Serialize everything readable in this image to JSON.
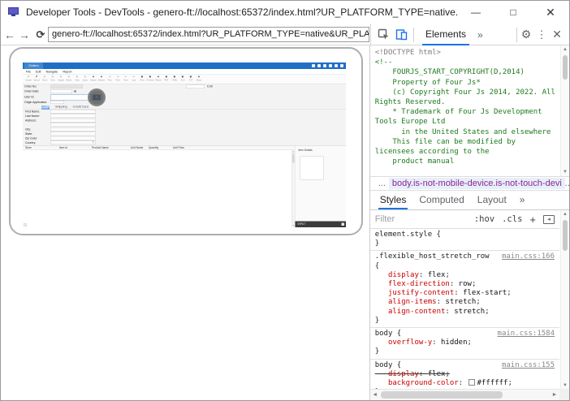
{
  "window": {
    "title": "Developer Tools - DevTools - genero-ft://localhost:65372/index.html?UR_PLATFORM_TYPE=native...",
    "minimize": "—",
    "maximize": "□",
    "close": "✕"
  },
  "navbar": {
    "back": "←",
    "forward": "→",
    "reload": "⟳",
    "url": "genero-ft://localhost:65372/index.html?UR_PLATFORM_TYPE=native&UR_PLATFORM_NAME"
  },
  "devtools": {
    "toolbar": {
      "elements_tab": "Elements",
      "more_tabs": "»",
      "menu_dots": "⋮",
      "close": "✕",
      "gear": "⚙"
    },
    "elements_code": [
      {
        "t": "<!DOCTYPE html>",
        "c": "doctype"
      },
      {
        "t": "<!--",
        "c": "comment"
      },
      {
        "t": "    FOURJS_START_COPYRIGHT(D,2014)",
        "c": "comment"
      },
      {
        "t": "    Property of Four Js*",
        "c": "comment"
      },
      {
        "t": "    (c) Copyright Four Js 2014, 2022. All",
        "c": "comment"
      },
      {
        "t": "Rights Reserved.",
        "c": "comment"
      },
      {
        "t": "    * Trademark of Four Js Development",
        "c": "comment"
      },
      {
        "t": "Tools Europe Ltd",
        "c": "comment"
      },
      {
        "t": "      in the United States and elsewhere",
        "c": "comment"
      },
      {
        "t": "",
        "c": "comment"
      },
      {
        "t": "    This file can be modified by",
        "c": "comment"
      },
      {
        "t": "licensees according to the",
        "c": "comment"
      },
      {
        "t": "    product manual",
        "c": "comment"
      }
    ],
    "crumbs": {
      "collapsed": "...",
      "selected": "body.is-not-mobile-device.is-not-touch-devi",
      "overflow": "..."
    },
    "styles_tabs": [
      "Styles",
      "Computed",
      "Layout",
      "»"
    ],
    "filter": {
      "placeholder": "Filter",
      "hov": ":hov",
      "cls": ".cls",
      "plus": "+"
    },
    "style_rules": [
      {
        "selector": "element.style",
        "link": "",
        "brace": "inline",
        "props": [],
        "close": true
      },
      {
        "selector": ".flexible_host_stretch_row",
        "link": "main.css:166",
        "brace": "ownline",
        "props": [
          {
            "name": "display",
            "value": "flex"
          },
          {
            "name": "flex-direction",
            "value": "row"
          },
          {
            "name": "justify-content",
            "value": "flex-start"
          },
          {
            "name": "align-items",
            "value": "stretch"
          },
          {
            "name": "align-content",
            "value": "stretch"
          }
        ],
        "close": true
      },
      {
        "selector": "body",
        "link": "main.css:1584",
        "brace": "inline",
        "props": [
          {
            "name": "overflow-y",
            "value": "hidden"
          }
        ],
        "close": true
      },
      {
        "selector": "body",
        "link": "main.css:155",
        "brace": "inline",
        "props": [
          {
            "name": "display",
            "value": "flex",
            "struck": true
          },
          {
            "name": "background-color",
            "value": "#ffffff",
            "swatch": "#ffffff"
          }
        ],
        "close": true
      }
    ]
  },
  "app": {
    "title_tab": "Orders",
    "menus": [
      "File",
      "Edit",
      "Navigate",
      "Report"
    ],
    "toolbar": [
      {
        "label": "Accept",
        "glyph": "✓",
        "on": true,
        "color": "#2e7d32"
      },
      {
        "label": "Cancel",
        "glyph": "✗",
        "on": true,
        "color": "#99392e"
      },
      {
        "label": "Close",
        "glyph": "■",
        "on": false
      },
      {
        "label": "New",
        "glyph": "■",
        "on": false
      },
      {
        "label": "Update",
        "glyph": "■",
        "on": false
      },
      {
        "label": "Delete",
        "glyph": "■",
        "on": false
      },
      {
        "label": "Clear",
        "glyph": "■",
        "on": false
      },
      {
        "label": "Query",
        "glyph": "■",
        "on": false
      },
      {
        "label": "Search",
        "glyph": "●",
        "on": true,
        "color": "#44566b"
      },
      {
        "label": "Browse",
        "glyph": "●",
        "on": true,
        "color": "#44566b"
      },
      {
        "label": "First",
        "glyph": "◄",
        "on": false
      },
      {
        "label": "Prev",
        "glyph": "◄",
        "on": false
      },
      {
        "label": "Next",
        "glyph": "►",
        "on": false
      },
      {
        "label": "Last",
        "glyph": "►",
        "on": false
      },
      {
        "label": "Print",
        "glyph": "■",
        "on": true,
        "color": "#4a5560"
      },
      {
        "label": "Preview",
        "glyph": "■",
        "on": true,
        "color": "#4a5560"
      },
      {
        "label": "Report",
        "glyph": "●",
        "on": true,
        "color": "#44566b"
      },
      {
        "label": "PDF",
        "glyph": "■",
        "on": true,
        "color": "#4a5560"
      },
      {
        "label": "HTML",
        "glyph": "■",
        "on": true,
        "color": "#4a5560"
      },
      {
        "label": "XLS",
        "glyph": "■",
        "on": true,
        "color": "#4a5560"
      },
      {
        "label": "TXT",
        "glyph": "■",
        "on": true,
        "color": "#4a5560"
      },
      {
        "label": "About",
        "glyph": "●",
        "on": true,
        "color": "#4a5560"
      }
    ],
    "order_fields": {
      "order_no": "Order No:",
      "order_date": "Order Date:",
      "user_id": "User Id:",
      "origin_app": "Origin Application:",
      "total": "0.00"
    },
    "tabs": [
      {
        "label": "Billing",
        "active": true
      },
      {
        "label": "Shipping",
        "active": false
      },
      {
        "label": "Credit Card",
        "active": false
      }
    ],
    "billing_labels": [
      "First Name:",
      "Last Name:",
      "Address:",
      "",
      "City:",
      "State:",
      "Zip Code:",
      "Country:"
    ],
    "table_headers": [
      "Store",
      "Item Id",
      "Product Name",
      "Unit Name",
      "Quantity",
      "Unit Price"
    ],
    "side_panel_label": "Item Details",
    "status_text": "INPUT"
  }
}
